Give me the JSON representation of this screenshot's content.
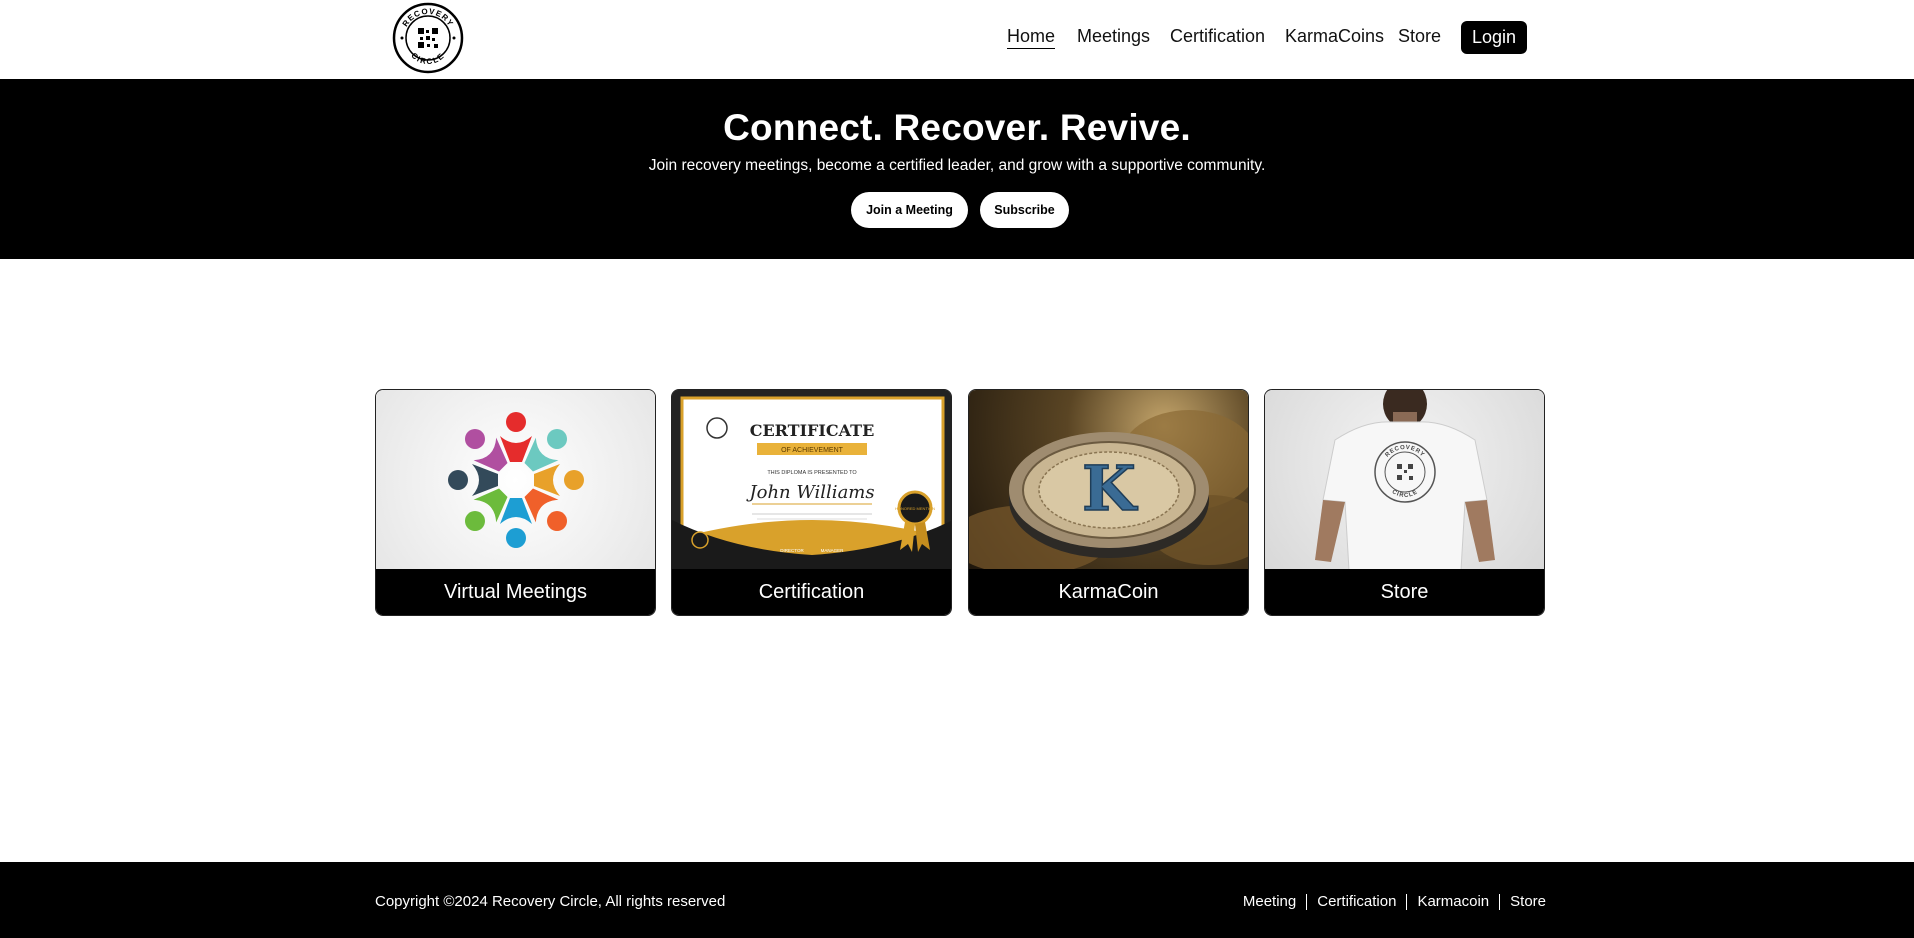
{
  "brand": {
    "logo_text_top": "RECOVERY",
    "logo_text_bottom": "CIRCLE"
  },
  "nav": {
    "home": "Home",
    "meetings": "Meetings",
    "certification": "Certification",
    "karmacoins": "KarmaCoins",
    "store": "Store",
    "login": "Login"
  },
  "hero": {
    "title": "Connect. Recover. Revive.",
    "subtitle": "Join recovery meetings, become a certified leader, and grow with a supportive community.",
    "join_button": "Join a Meeting",
    "subscribe_button": "Subscribe"
  },
  "cards": [
    {
      "label": "Virtual Meetings",
      "icon": "community-circle-icon"
    },
    {
      "label": "Certification",
      "icon": "certificate-image",
      "cert_title": "CERTIFICATE",
      "cert_sub": "OF ACHIEVEMENT",
      "cert_line": "THIS DIPLOMA IS PRESENTED TO",
      "cert_name": "John Williams",
      "cert_director": "DIRECTOR",
      "cert_manager": "MANAGER",
      "cert_seal": "HONORED MENTION"
    },
    {
      "label": "KarmaCoin",
      "icon": "karmacoin-image",
      "coin_letter": "K"
    },
    {
      "label": "Store",
      "icon": "tshirt-image",
      "shirt_top": "RECOVERY",
      "shirt_bottom": "CIRCLE"
    }
  ],
  "footer": {
    "copyright": "Copyright ©2024 Recovery Circle, All rights reserved",
    "links": [
      "Meeting",
      "Certification",
      "Karmacoin",
      "Store"
    ]
  },
  "colors": {
    "dark": "#000000",
    "light": "#ffffff",
    "gold": "#d9a12b",
    "coin_blue": "#3a6b94"
  }
}
